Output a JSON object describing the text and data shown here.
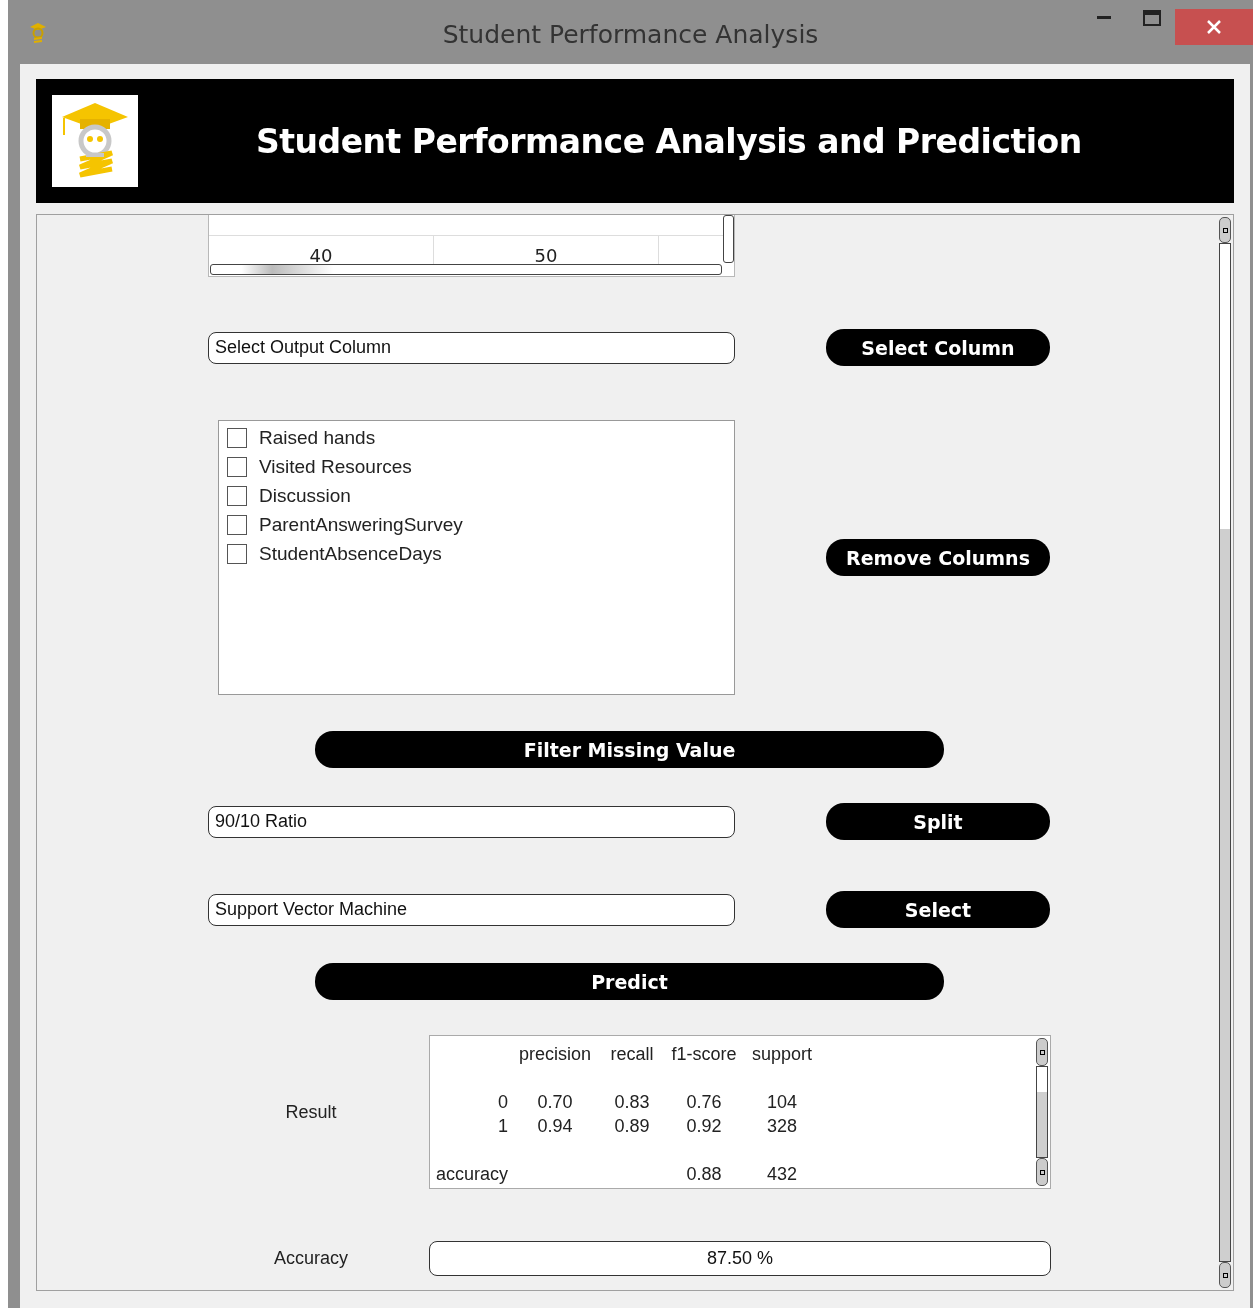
{
  "window": {
    "title": "Student Performance Analysis"
  },
  "header": {
    "title": "Student Performance Analysis and Prediction"
  },
  "data_table": {
    "rows": [
      [
        "40",
        "50"
      ]
    ]
  },
  "output_column": {
    "value": "Select Output Column",
    "button": "Select Column"
  },
  "columns_list": [
    {
      "label": "Raised hands",
      "checked": false
    },
    {
      "label": "Visited Resources",
      "checked": false
    },
    {
      "label": "Discussion",
      "checked": false
    },
    {
      "label": "ParentAnsweringSurvey",
      "checked": false
    },
    {
      "label": "StudentAbsenceDays",
      "checked": false
    }
  ],
  "remove_button": "Remove Columns",
  "filter_button": "Filter Missing Value",
  "split": {
    "value": "90/10 Ratio",
    "button": "Split"
  },
  "model": {
    "value": "Support Vector Machine",
    "button": "Select"
  },
  "predict_button": "Predict",
  "result": {
    "label": "Result",
    "columns": [
      "",
      "precision",
      "recall",
      "f1-score",
      "support"
    ],
    "rows": [
      [
        "0",
        "0.70",
        "0.83",
        "0.76",
        "104"
      ],
      [
        "1",
        "0.94",
        "0.89",
        "0.92",
        "328"
      ],
      [
        "accuracy",
        "",
        "",
        "0.88",
        "432"
      ]
    ]
  },
  "accuracy": {
    "label": "Accuracy",
    "value": "87.50 %"
  }
}
